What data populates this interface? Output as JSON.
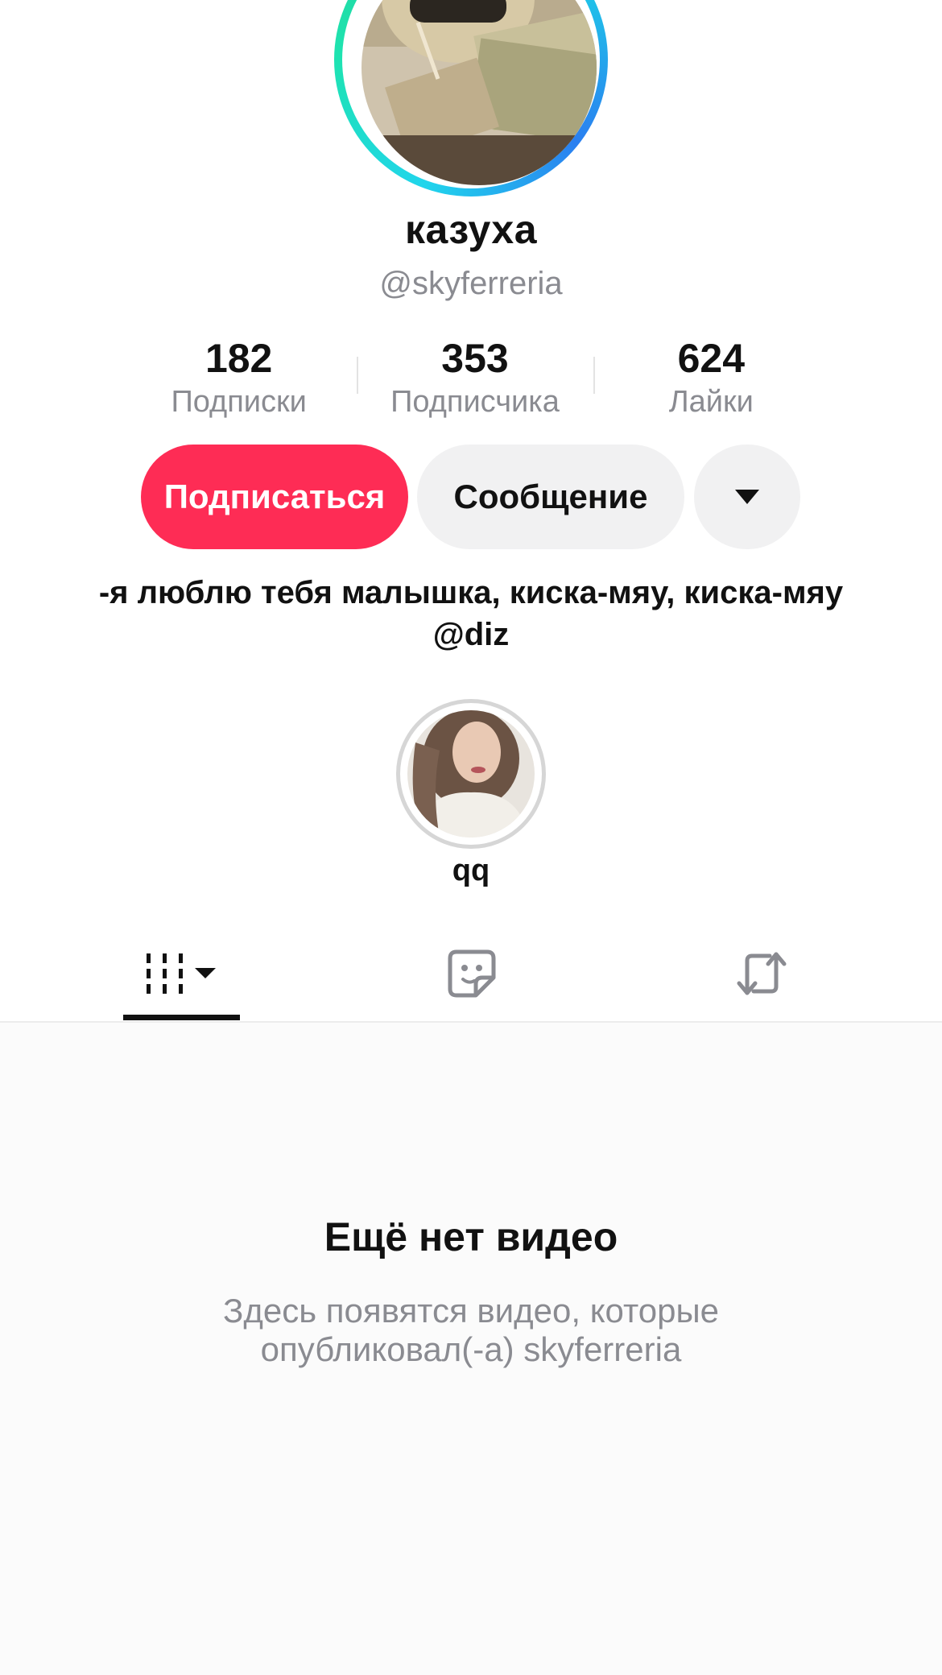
{
  "profile": {
    "display_name": "казуха",
    "username": "@skyferreria",
    "bio": "-я люблю тебя малышка, киска-мяу, киска-мяу @diz",
    "ring_colors": [
      "#20d5ec",
      "#1ee3b0",
      "#2a7ff0"
    ]
  },
  "stats": [
    {
      "value": "182",
      "label": "Подписки"
    },
    {
      "value": "353",
      "label": "Подписчика"
    },
    {
      "value": "624",
      "label": "Лайки"
    }
  ],
  "actions": {
    "follow_label": "Подписаться",
    "message_label": "Сообщение",
    "more_icon": "caret-down-icon",
    "follow_color": "#fe2c55"
  },
  "highlight": {
    "label": "qq"
  },
  "tabs": [
    {
      "icon": "videos-grid-icon",
      "active": true
    },
    {
      "icon": "liked-sticker-icon",
      "active": false
    },
    {
      "icon": "repost-icon",
      "active": false
    }
  ],
  "empty_state": {
    "title": "Ещё нет видео",
    "subtitle": "Здесь появятся видео, которые опубликовал(-а) skyferreria"
  }
}
